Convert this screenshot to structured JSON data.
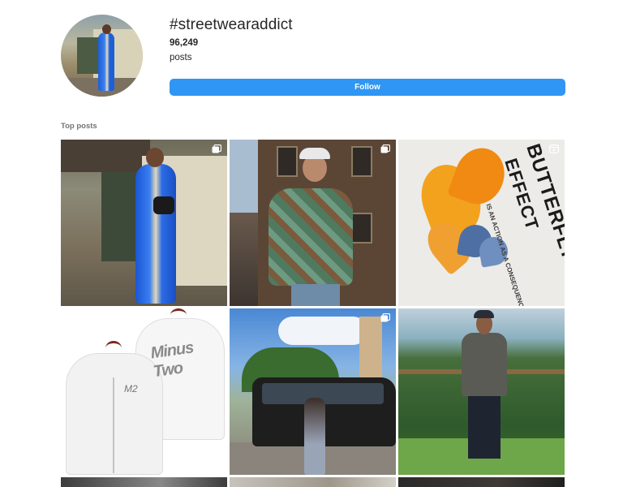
{
  "header": {
    "hashtag": "#streetwearaddict",
    "post_count": "96,249",
    "post_label": "posts",
    "follow_label": "Follow"
  },
  "section": {
    "title": "Top posts"
  },
  "colors": {
    "accent": "#2f96f3",
    "text": "#262626",
    "muted": "#737373"
  },
  "posts": [
    {
      "type": "carousel",
      "icon": "carousel-icon",
      "description": ""
    },
    {
      "type": "carousel",
      "icon": "carousel-icon",
      "description": ""
    },
    {
      "type": "reel",
      "icon": "reel-icon",
      "print_line1": "BUTTERFLY",
      "print_line2": "EFFECT",
      "print_small": "IS AN ACTION AS A CONSEQUENCE"
    },
    {
      "type": "image",
      "icon": "",
      "graffiti": "Minus Two",
      "logo": "M2"
    },
    {
      "type": "carousel",
      "icon": "carousel-icon"
    },
    {
      "type": "image",
      "icon": ""
    }
  ]
}
